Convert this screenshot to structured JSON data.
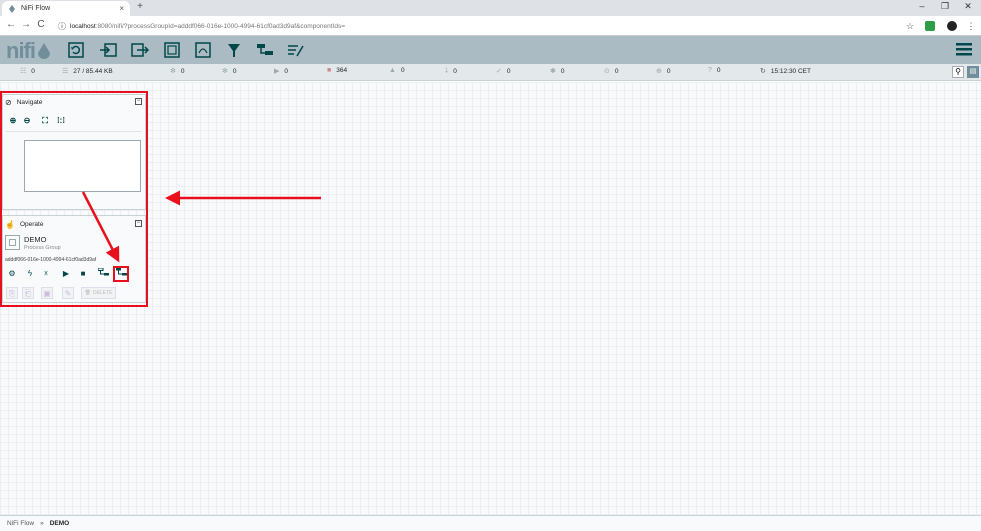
{
  "browser": {
    "tab_title": "NiFi Flow",
    "tab_close": "×",
    "new_tab": "+",
    "url_host": "localhost",
    "url_rest": ":8080/nifi/?processGroupId=adddf066-016e-1000-4994-61cf0ad3d9af&componentIds=",
    "minimize": "–",
    "restore": "❐",
    "close": "✕"
  },
  "header": {
    "logo": "nifi",
    "tools": [
      "processor-icon",
      "input-port-icon",
      "output-port-icon",
      "process-group-icon",
      "remote-process-group-icon",
      "funnel-icon",
      "template-icon",
      "label-icon"
    ]
  },
  "stats": {
    "transmitting_count": "0",
    "queued": "27 / 85.44 KB",
    "transmitting_remote": "0",
    "not_transmitting_remote": "0",
    "running": "0",
    "stopped": "364",
    "invalid": "0",
    "disabled": "0",
    "up_to_date": "0",
    "locally_modified": "0",
    "stale": "0",
    "locally_modified_stale": "0",
    "sync_failure": "0",
    "last_refreshed": "15:12:30 CET"
  },
  "navigate": {
    "title": "Navigate"
  },
  "operate": {
    "title": "Operate",
    "component_name": "DEMO",
    "component_type": "Process Group",
    "component_id": "adddf066-016e-1000-4994-61cf0ad3d9af",
    "delete_label": "DELETE"
  },
  "breadcrumb": {
    "root": "NiFi Flow",
    "separator": "»",
    "current": "DEMO"
  },
  "colors": {
    "header": "#aabbc3",
    "accent": "#004849",
    "annotation": "#e8101c"
  }
}
